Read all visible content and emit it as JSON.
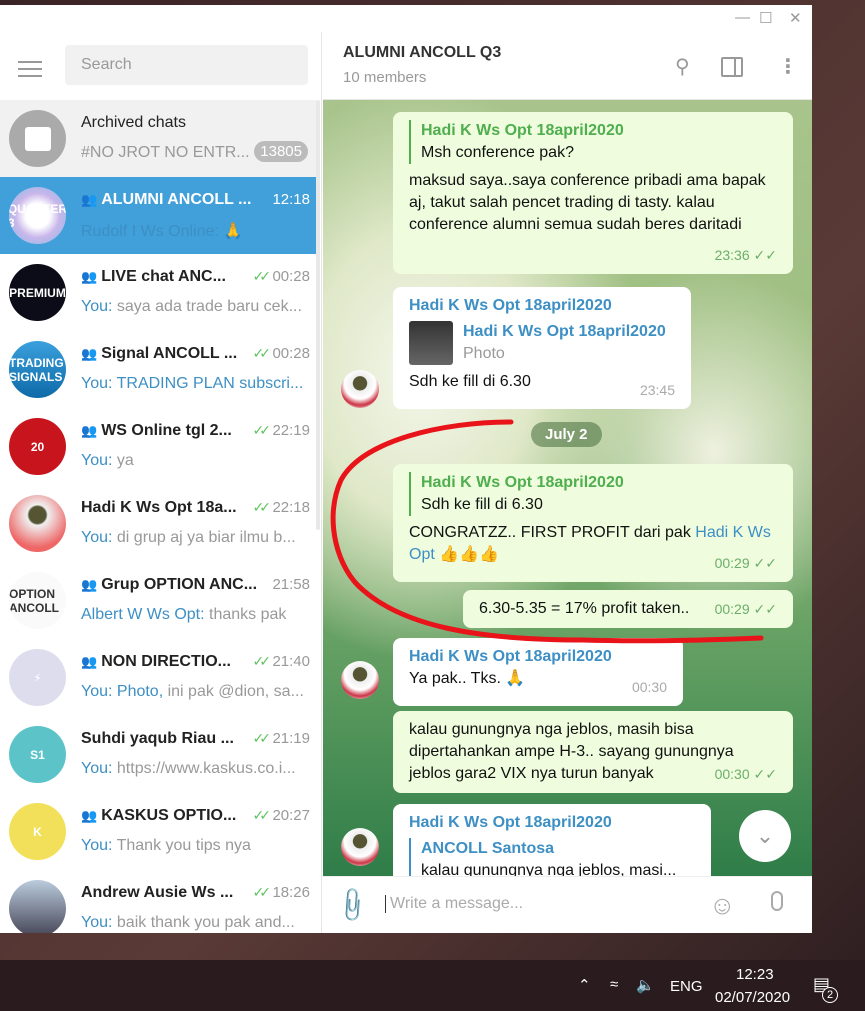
{
  "window": {
    "minimize": "—",
    "maximize": "☐",
    "close": "✕"
  },
  "search": {
    "placeholder": "Search"
  },
  "chats": [
    {
      "name": "Archived chats",
      "preview": "#NO JROT NO ENTR...",
      "badge": "13805",
      "icon": "archive-icon"
    },
    {
      "name": "ALUMNI ANCOLL ...",
      "time": "12:18",
      "sender": "Rudolf I Ws Online:",
      "preview": " 🙏",
      "group": true,
      "avatar_text": "QUARTER 3"
    },
    {
      "name": "LIVE chat ANC...",
      "time": "00:28",
      "sender": "You:",
      "preview": " saya ada trade baru cek...",
      "group": true,
      "read": true,
      "avatar_text": "PREMIUM"
    },
    {
      "name": "Signal ANCOLL ...",
      "time": "00:28",
      "sender": "You:",
      "preview": " TRADING PLAN subscri...",
      "preview_link": true,
      "group": true,
      "read": true,
      "avatar_text": "TRADING SIGNALS"
    },
    {
      "name": "WS Online tgl 2...",
      "time": "22:19",
      "sender": "You:",
      "preview": " ya",
      "group": true,
      "read": true,
      "avatar_text": "20"
    },
    {
      "name": "Hadi K Ws Opt 18a...",
      "time": "22:18",
      "sender": "You:",
      "preview": " di grup aj ya biar ilmu b...",
      "read": true,
      "avatar_text": ""
    },
    {
      "name": "Grup OPTION ANC...",
      "time": "21:58",
      "sender": "Albert W Ws Opt:",
      "preview": " thanks pak",
      "group": true,
      "avatar_text": "OPTION ANCOLL"
    },
    {
      "name": "NON DIRECTIO...",
      "time": "21:40",
      "sender": "You: Photo,",
      "preview": " ini pak @dion, sa...",
      "group": true,
      "read": true,
      "avatar_text": "⚡"
    },
    {
      "name": "Suhdi yaqub Riau ...",
      "time": "21:19",
      "sender": "You:",
      "preview": " https://www.kaskus.co.i...",
      "read": true,
      "avatar_text": "S1"
    },
    {
      "name": "KASKUS OPTIO...",
      "time": "20:27",
      "sender": "You:",
      "preview": " Thank you tips nya",
      "group": true,
      "read": true,
      "avatar_text": "K"
    },
    {
      "name": "Andrew Ausie Ws ...",
      "time": "18:26",
      "sender": "You:",
      "preview": " baik thank you pak and...",
      "read": true,
      "avatar_text": ""
    }
  ],
  "header": {
    "title": "ALUMNI ANCOLL Q3",
    "subtitle": "10 members"
  },
  "messages": {
    "m1": {
      "fwd_name": "Hadi K Ws Opt 18april2020",
      "fwd_text": "Msh conference pak?",
      "text": "maksud saya..saya conference pribadi ama bapak aj, takut salah pencet trading di tasty. kalau conference alumni semua sudah beres daritadi",
      "time": "23:36"
    },
    "m2": {
      "sender": "Hadi K Ws Opt 18april2020",
      "reply_name": "Hadi K Ws Opt 18april2020",
      "reply_text": "Photo",
      "text": "Sdh ke fill di 6.30",
      "time": "23:45"
    },
    "date": "July 2",
    "m3": {
      "fwd_name": "Hadi K Ws Opt 18april2020",
      "fwd_text": "Sdh ke fill di 6.30",
      "text": "CONGRATZZ.. FIRST PROFIT dari pak ",
      "mention": "Hadi K Ws Opt",
      "emoji": " 👍👍👍",
      "time": "00:29"
    },
    "m4": {
      "text": "6.30-5.35 = 17% profit taken..",
      "time": "00:29"
    },
    "m5": {
      "sender": "Hadi K Ws Opt 18april2020",
      "text": "Ya pak.. Tks. 🙏",
      "time": "00:30"
    },
    "m6": {
      "text": "kalau gunungnya nga jeblos, masih bisa dipertahankan ampe H-3.. sayang gunungnya jeblos gara2 VIX nya turun banyak",
      "time": "00:30"
    },
    "m7": {
      "sender": "Hadi K Ws Opt 18april2020",
      "reply_name": "ANCOLL Santosa",
      "reply_text": "kalau gunungnya nga jeblos, masi..."
    }
  },
  "composer": {
    "placeholder": "Write a message..."
  },
  "taskbar": {
    "lang": "ENG",
    "time": "12:23",
    "date": "02/07/2020",
    "notifications": "2"
  },
  "colors": {
    "accent": "#419fd9",
    "read_ticks": "#5ec35e",
    "annotation": "#e8141a"
  }
}
